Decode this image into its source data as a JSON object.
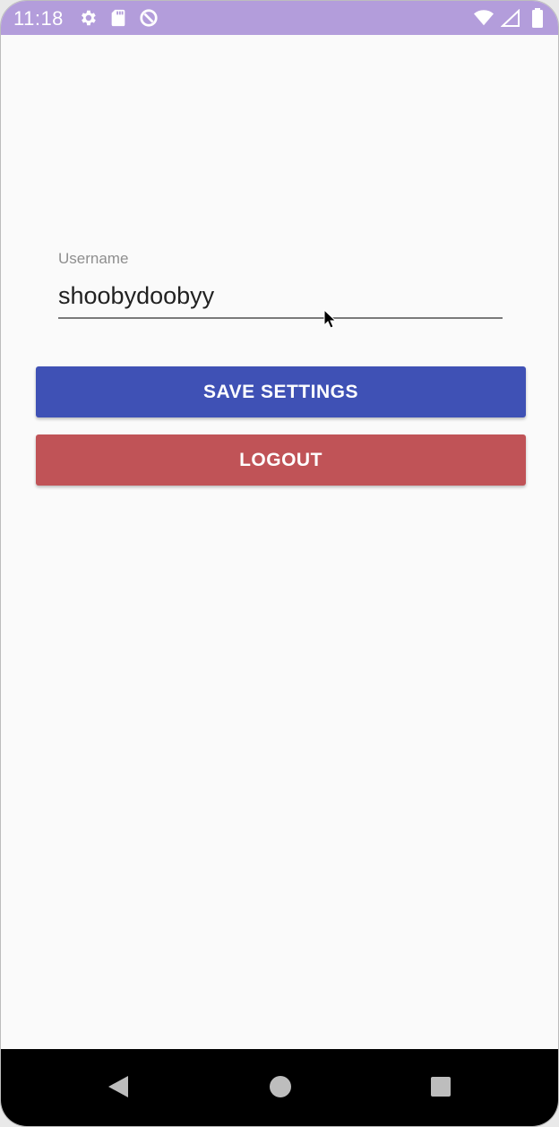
{
  "status_bar": {
    "time": "11:18",
    "left_icons": [
      "gear-icon",
      "sd-card-icon",
      "data-saver-icon"
    ],
    "right_icons": [
      "wifi-icon",
      "signal-icon",
      "battery-icon"
    ],
    "color": "#b39ddb"
  },
  "settings": {
    "username_label": "Username",
    "username_value": "shoobydoobyy",
    "save_label": "SAVE SETTINGS",
    "logout_label": "LOGOUT"
  },
  "colors": {
    "save_button": "#3f51b5",
    "logout_button": "#c05357",
    "background": "#fafafa",
    "nav_bar": "#000000"
  },
  "nav_bar": {
    "buttons": [
      "back-icon",
      "home-icon",
      "recents-icon"
    ]
  }
}
